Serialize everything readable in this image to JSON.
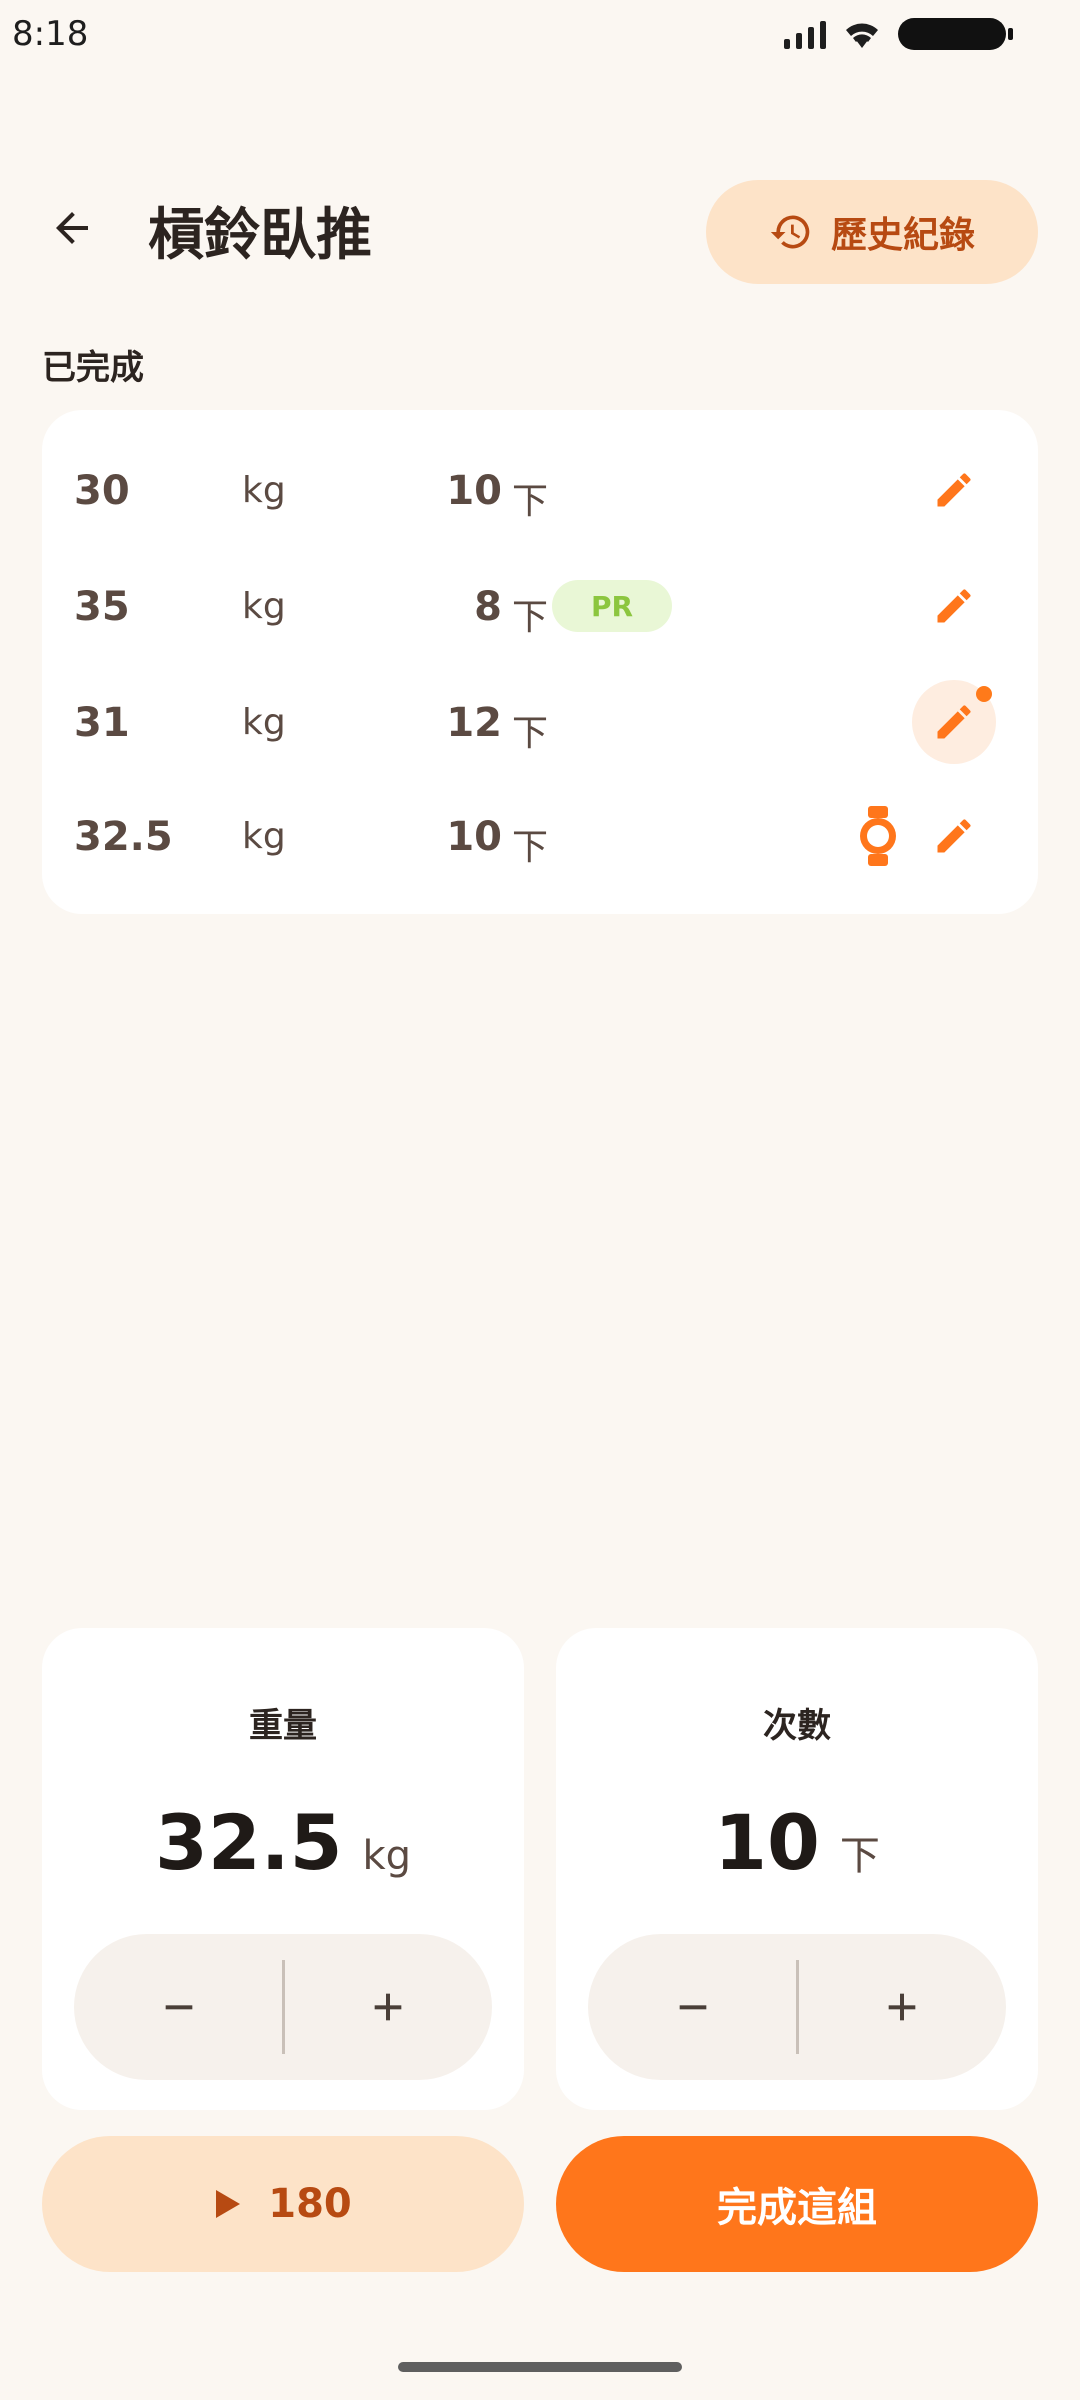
{
  "status_bar": {
    "time": "8:18"
  },
  "header": {
    "title": "槓鈴臥推",
    "history_label": "歷史紀錄"
  },
  "completed": {
    "label": "已完成",
    "sets": [
      {
        "weight": "30",
        "unit": "kg",
        "reps": "10",
        "reps_unit": "下"
      },
      {
        "weight": "35",
        "unit": "kg",
        "reps": "8",
        "reps_unit": "下",
        "badge": "PR"
      },
      {
        "weight": "31",
        "unit": "kg",
        "reps": "12",
        "reps_unit": "下"
      },
      {
        "weight": "32.5",
        "unit": "kg",
        "reps": "10",
        "reps_unit": "下"
      }
    ]
  },
  "weight_stepper": {
    "title": "重量",
    "value": "32.5",
    "unit": "kg"
  },
  "reps_stepper": {
    "title": "次數",
    "value": "10",
    "unit": "下"
  },
  "actions": {
    "timer_label": "180",
    "done_label": "完成這組"
  },
  "colors": {
    "accent": "#FF761B",
    "accent_soft": "#FDE3C8",
    "accent_text": "#B74A12",
    "pr_bg": "#E9F7D6",
    "pr_text": "#8CC63F",
    "background": "#FBF7F2"
  },
  "icons": {
    "back": "arrow-left-icon",
    "history": "history-icon",
    "edit": "pencil-icon",
    "watch": "watch-icon",
    "minus": "minus-icon",
    "plus": "plus-icon",
    "play": "play-icon"
  }
}
